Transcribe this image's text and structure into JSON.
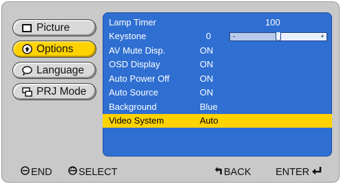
{
  "menu": {
    "items": [
      {
        "label": "Picture",
        "icon": "picture-icon"
      },
      {
        "label": "Options",
        "icon": "options-icon"
      },
      {
        "label": "Language",
        "icon": "language-icon"
      },
      {
        "label": "PRJ Mode",
        "icon": "prj-mode-icon"
      }
    ],
    "active_index": 1
  },
  "settings": [
    {
      "label": "Lamp Timer",
      "value": "100"
    },
    {
      "label": "Keystone",
      "value": "0"
    },
    {
      "label": "AV Mute Disp.",
      "value": "ON"
    },
    {
      "label": "OSD Display",
      "value": "ON"
    },
    {
      "label": "Auto Power Off",
      "value": "ON"
    },
    {
      "label": "Auto Source",
      "value": "ON"
    },
    {
      "label": "Background",
      "value": "Blue"
    },
    {
      "label": "Video System",
      "value": "Auto"
    }
  ],
  "selected_index": 7,
  "keystone_slider": {
    "minus": "-",
    "plus": "+",
    "level": 0.5
  },
  "bottom_bar": {
    "end": "END",
    "select": "SELECT",
    "back": "BACK",
    "enter": "ENTER"
  },
  "colors": {
    "panel_blue": "#2f6fd2",
    "highlight_yellow": "#ffd200",
    "frame_gray": "#c9c9c9"
  }
}
